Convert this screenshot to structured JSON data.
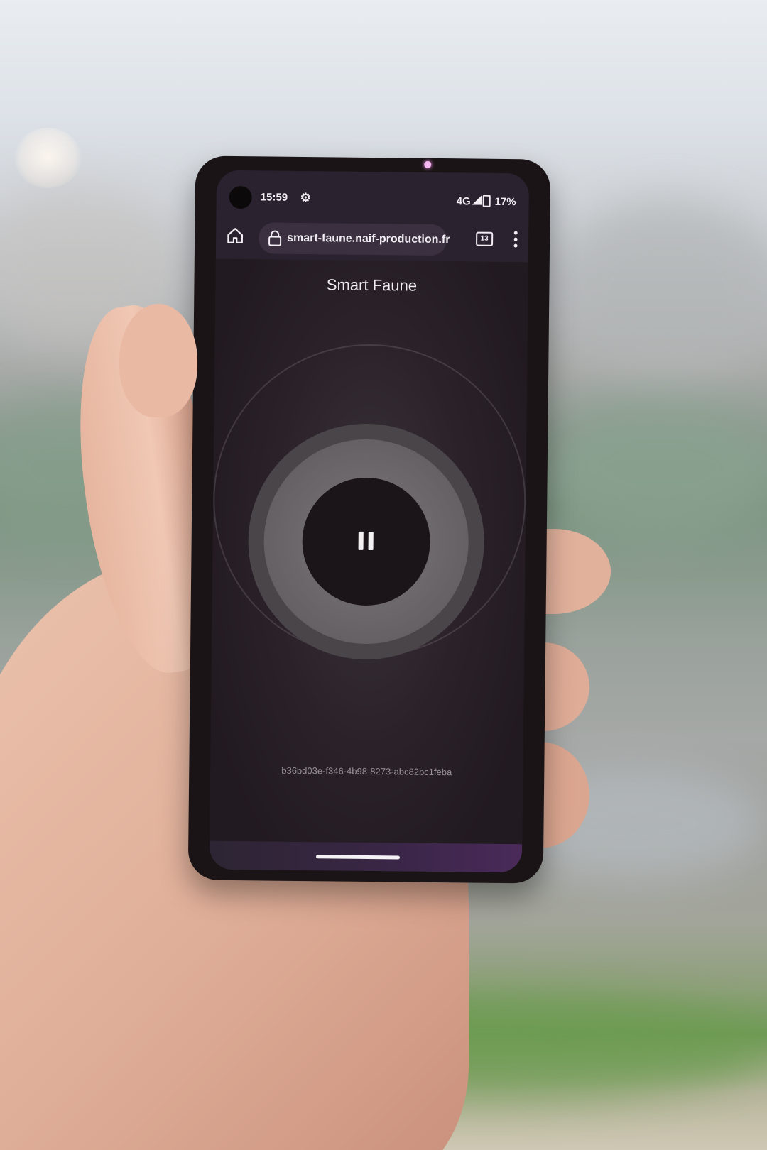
{
  "status_bar": {
    "time": "15:59",
    "settings_icon": "gear-icon",
    "network": "4G",
    "battery": "17%"
  },
  "browser": {
    "url": "smart-faune.naif-production.fr",
    "tab_count": "13",
    "home_icon": "home-icon",
    "lock_icon": "lock-icon",
    "menu_icon": "kebab-menu-icon"
  },
  "app": {
    "title": "Smart Faune",
    "play_state_icon": "pause-icon",
    "device_id": "b36bd03e-f346-4b98-8273-abc82bc1feba"
  },
  "colors": {
    "app_background": "#241d22",
    "browser_bar": "#2b2230",
    "pause_button": "#1b1419"
  }
}
